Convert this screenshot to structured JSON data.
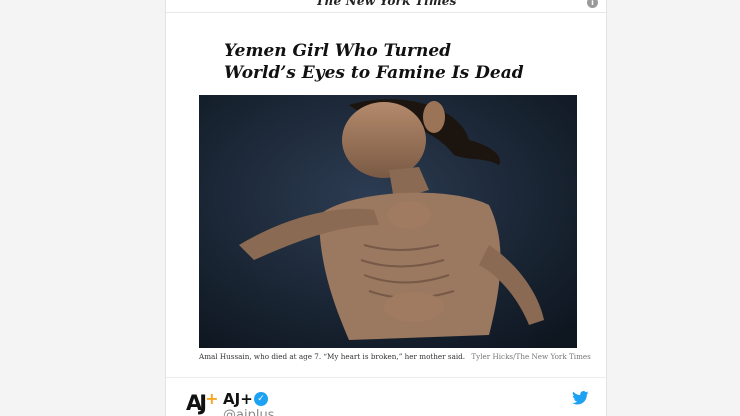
{
  "masthead": {
    "title": "The New York Times",
    "info_icon": "info-icon"
  },
  "article": {
    "headline": "Yemen Girl Who Turned World’s Eyes to Famine Is Dead",
    "photo_icon": "news-photo",
    "caption": "Amal Hussain, who died at age 7. “My heart is broken,” her mother said.",
    "credit": "Tyler Hicks/The New York Times"
  },
  "tweet": {
    "logo_text": "AJ",
    "logo_plus": "+",
    "name": "AJ+",
    "verified_icon": "verified-badge-icon",
    "handle": "@ajplus",
    "twitter_icon": "twitter-bird-icon"
  },
  "colors": {
    "verified": "#1da1f2",
    "twitter": "#1da1f2",
    "aj_accent": "#f5a623"
  }
}
